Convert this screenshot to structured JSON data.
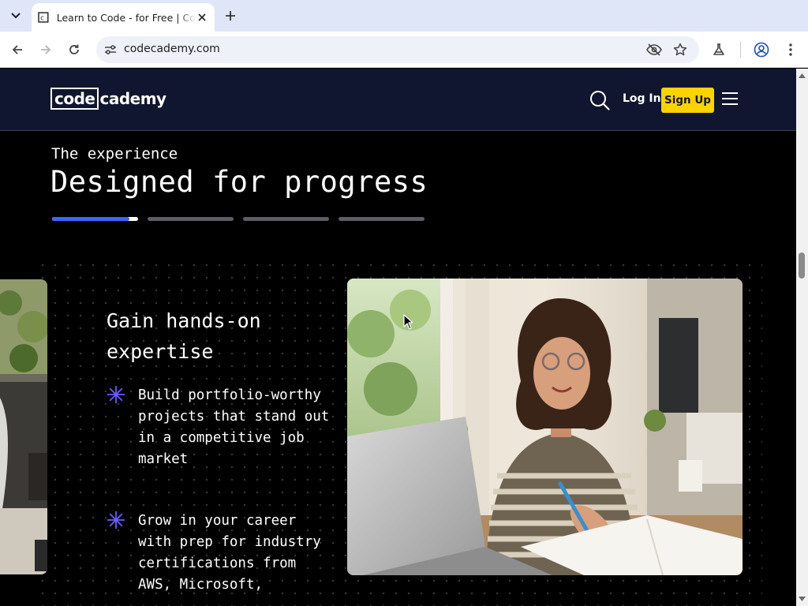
{
  "browser": {
    "tab_title": "Learn to Code - for Free | Codecademy",
    "url": "codecademy.com"
  },
  "header": {
    "logo_boxed": "code",
    "logo_rest": "cademy",
    "login_label": "Log In",
    "signup_label": "Sign Up"
  },
  "section": {
    "eyebrow": "The experience",
    "headline": "Designed for progress",
    "progress_segments": 4,
    "active_segment_fill": 0.9
  },
  "card": {
    "title": "Gain hands-on expertise",
    "bullets": [
      "Build portfolio-worthy projects that stand out in a competitive job market",
      "Grow in your career with prep for industry certifications from AWS, Microsoft,"
    ]
  },
  "colors": {
    "header_bg": "#10162f",
    "signup_bg": "#ffd300",
    "accent_blue": "#3a66ff",
    "bullet_star": "#6b5cff"
  }
}
